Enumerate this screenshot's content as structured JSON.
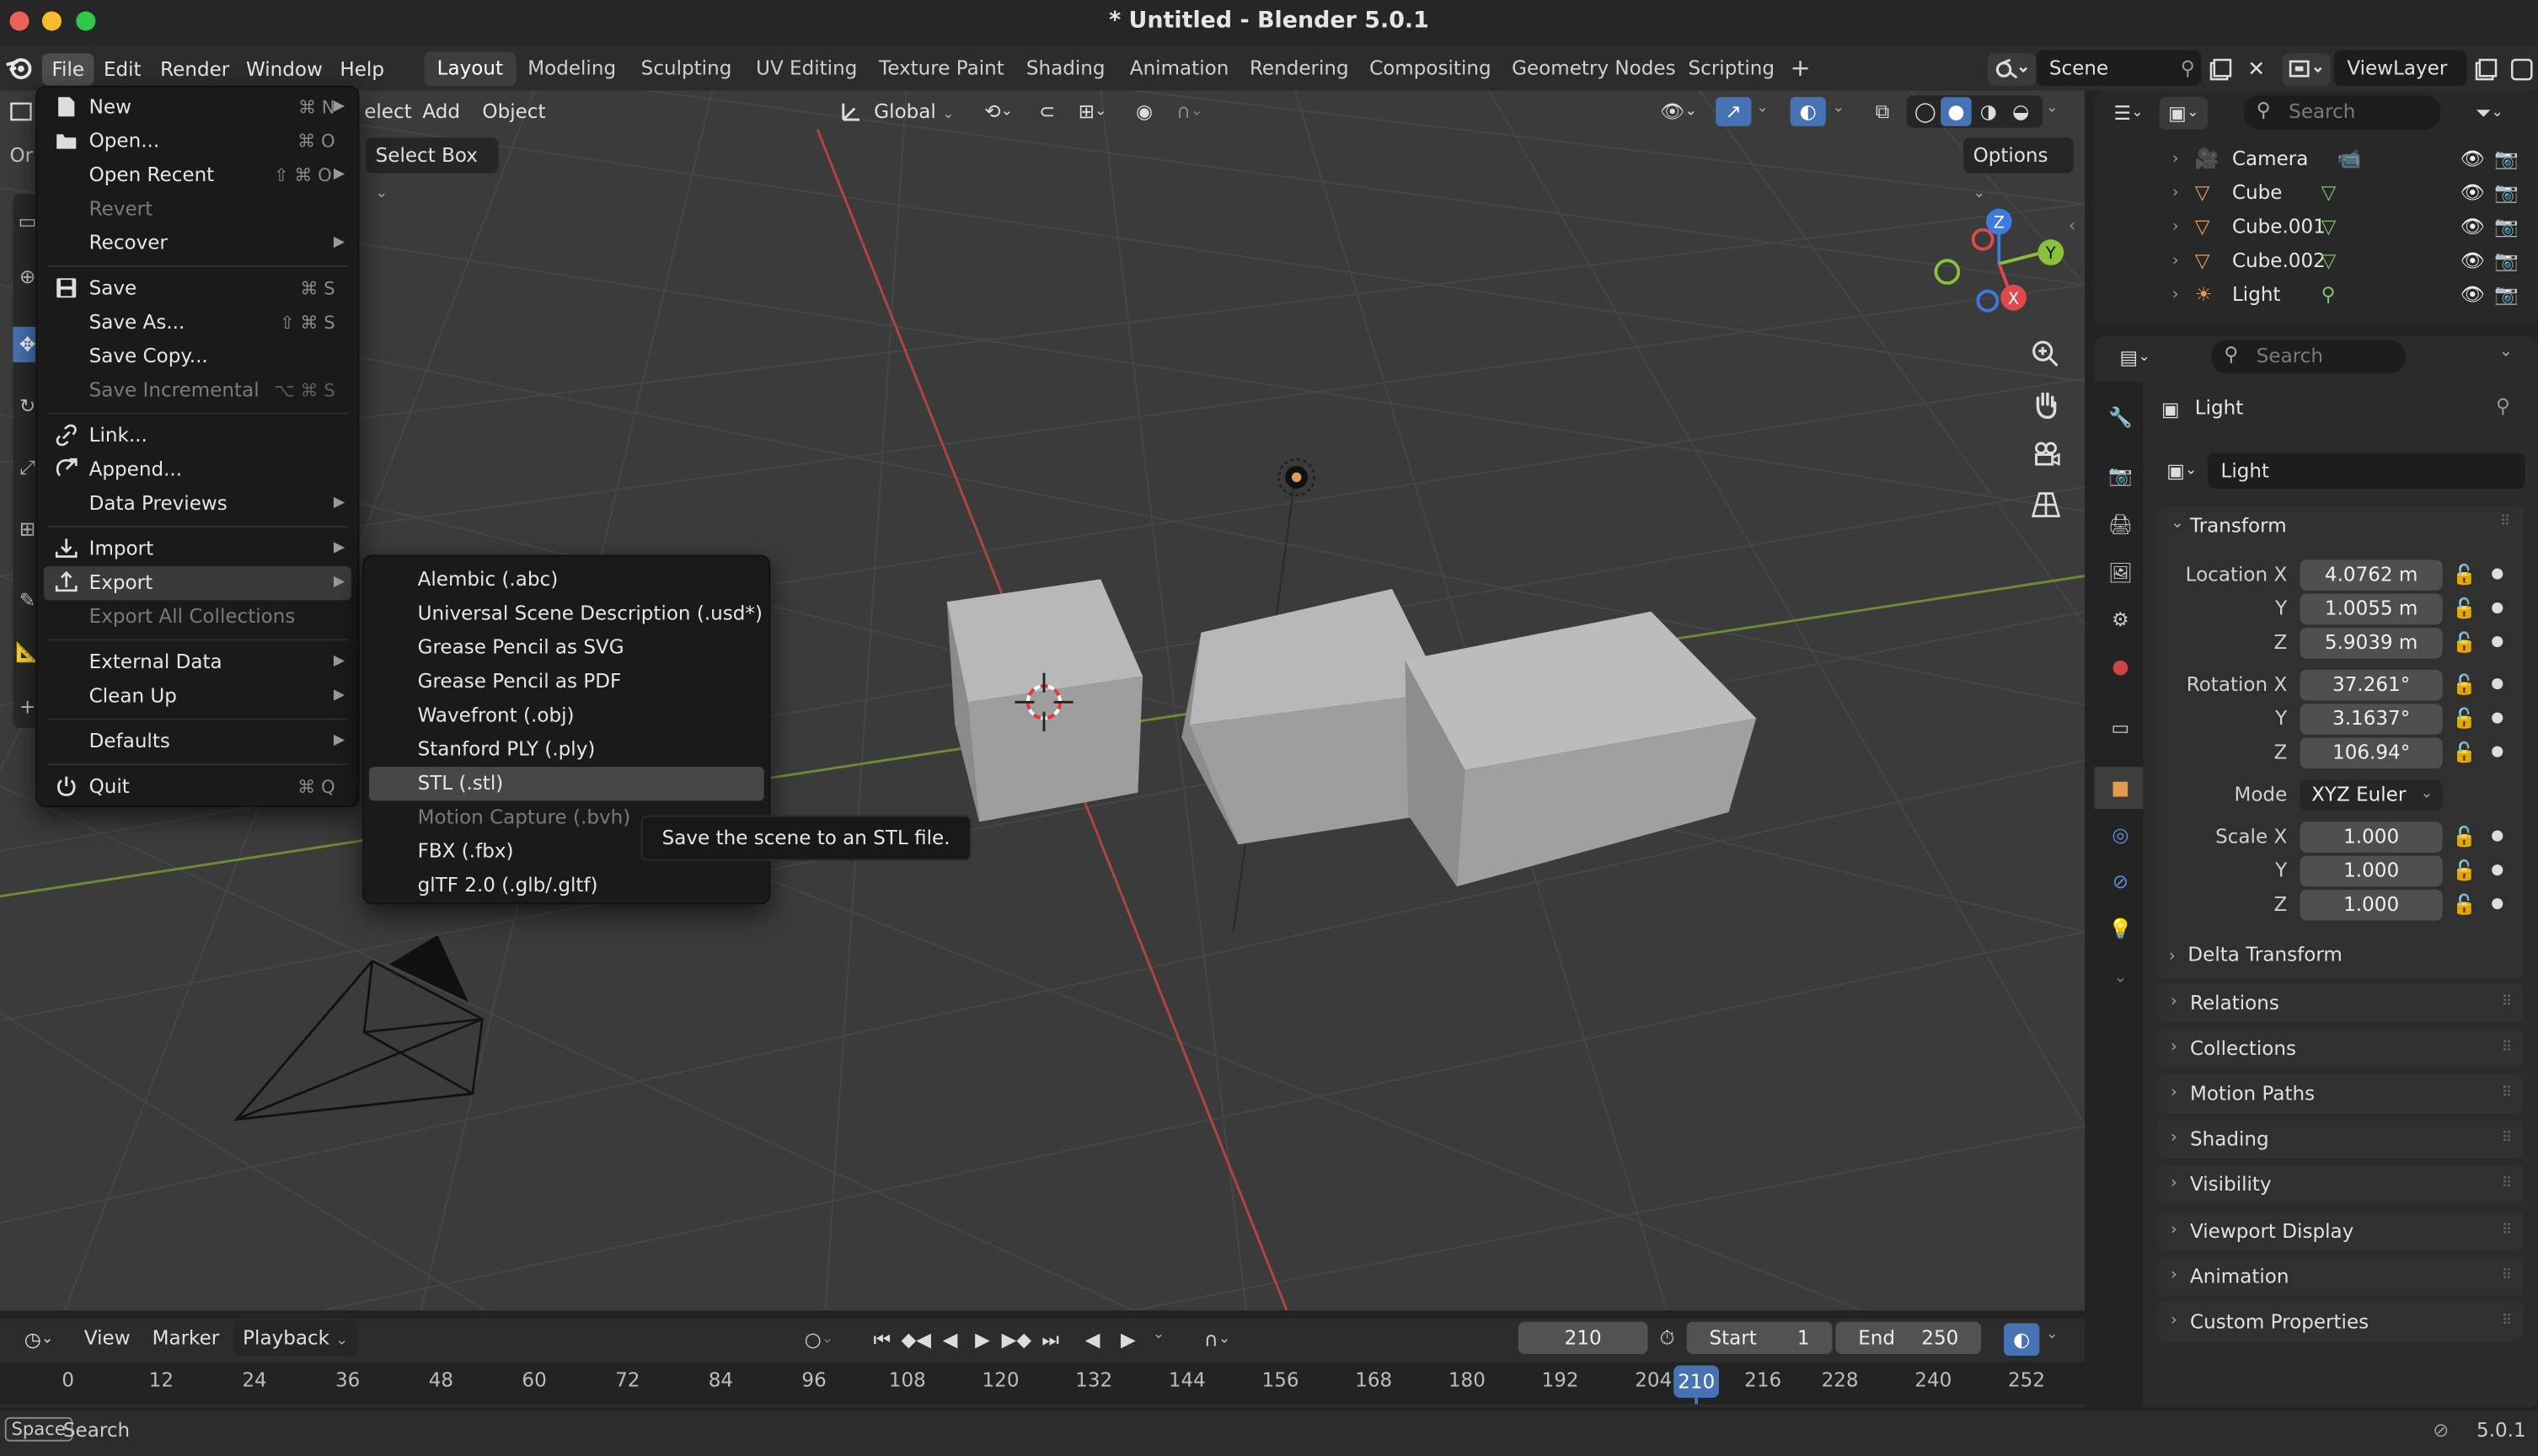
{
  "window": {
    "title": "* Untitled - Blender 5.0.1"
  },
  "menubar": {
    "items": [
      "File",
      "Edit",
      "Render",
      "Window",
      "Help"
    ],
    "workspaces": [
      "Layout",
      "Modeling",
      "Sculpting",
      "UV Editing",
      "Texture Paint",
      "Shading",
      "Animation",
      "Rendering",
      "Compositing",
      "Geometry Nodes",
      "Scripting"
    ],
    "active_workspace": "Layout",
    "add_tab": "+",
    "scene": "Scene",
    "view_layer": "ViewLayer"
  },
  "viewport_header": {
    "select_partial": "elect",
    "add": "Add",
    "object": "Object",
    "transform_orientation": "Global",
    "select_mode": "Select Box",
    "options": "Options",
    "left_partial": "Or"
  },
  "file_menu": {
    "items": [
      {
        "label": "New",
        "shortcut": "⌘ N",
        "submenu": true,
        "icon": "new-file-icon",
        "disabled": false
      },
      {
        "label": "Open...",
        "shortcut": "⌘ O",
        "icon": "folder-icon",
        "disabled": false
      },
      {
        "label": "Open Recent",
        "shortcut": "⇧ ⌘ O",
        "submenu": true,
        "disabled": false
      },
      {
        "label": "Revert",
        "disabled": true
      },
      {
        "label": "Recover",
        "submenu": true,
        "disabled": false
      },
      {
        "label": "Save",
        "shortcut": "⌘ S",
        "icon": "save-icon",
        "disabled": false
      },
      {
        "label": "Save As...",
        "shortcut": "⇧ ⌘ S",
        "disabled": false
      },
      {
        "label": "Save Copy...",
        "disabled": false
      },
      {
        "label": "Save Incremental",
        "shortcut": "⌥ ⌘ S",
        "disabled": true
      },
      {
        "label": "Link...",
        "icon": "link-icon",
        "disabled": false
      },
      {
        "label": "Append...",
        "icon": "append-icon",
        "disabled": false
      },
      {
        "label": "Data Previews",
        "submenu": true,
        "disabled": false
      },
      {
        "label": "Import",
        "submenu": true,
        "icon": "import-icon",
        "disabled": false
      },
      {
        "label": "Export",
        "submenu": true,
        "icon": "export-icon",
        "disabled": false,
        "highlighted": true
      },
      {
        "label": "Export All Collections",
        "disabled": true
      },
      {
        "label": "External Data",
        "submenu": true,
        "disabled": false
      },
      {
        "label": "Clean Up",
        "submenu": true,
        "disabled": false
      },
      {
        "label": "Defaults",
        "submenu": true,
        "disabled": false
      },
      {
        "label": "Quit",
        "shortcut": "⌘ Q",
        "icon": "power-icon",
        "disabled": false
      }
    ]
  },
  "export_menu": {
    "items": [
      {
        "label": "Alembic (.abc)",
        "disabled": false
      },
      {
        "label": "Universal Scene Description (.usd*)",
        "disabled": false
      },
      {
        "label": "Grease Pencil as SVG",
        "disabled": false
      },
      {
        "label": "Grease Pencil as PDF",
        "disabled": false
      },
      {
        "label": "Wavefront (.obj)",
        "disabled": false
      },
      {
        "label": "Stanford PLY (.ply)",
        "disabled": false
      },
      {
        "label": "STL (.stl)",
        "disabled": false,
        "highlighted": true
      },
      {
        "label": "Motion Capture (.bvh)",
        "disabled": true
      },
      {
        "label": "FBX (.fbx)",
        "disabled": false
      },
      {
        "label": "glTF 2.0 (.glb/.gltf)",
        "disabled": false
      }
    ],
    "tooltip": "Save the scene to an STL file."
  },
  "outliner": {
    "search_placeholder": "Search",
    "rows": [
      {
        "name": "Camera",
        "icon": "camera-object-icon",
        "data_icon": "camera-data-icon"
      },
      {
        "name": "Cube",
        "icon": "mesh-object-icon",
        "data_icon": "mesh-data-icon"
      },
      {
        "name": "Cube.001",
        "icon": "mesh-object-icon",
        "data_icon": "mesh-data-icon"
      },
      {
        "name": "Cube.002",
        "icon": "mesh-object-icon",
        "data_icon": "mesh-data-icon"
      },
      {
        "name": "Light",
        "icon": "light-object-icon",
        "data_icon": "light-data-icon"
      }
    ]
  },
  "properties": {
    "search_placeholder": "Search",
    "object_name": "Light",
    "datablock_name": "Light",
    "transform_header": "Transform",
    "location": {
      "label": "Location X",
      "x": "4.0762 m",
      "y": "1.0055 m",
      "z": "5.9039 m"
    },
    "rotation": {
      "label": "Rotation X",
      "x": "37.261°",
      "y": "3.1637°",
      "z": "106.94°"
    },
    "mode": {
      "label": "Mode",
      "value": "XYZ Euler"
    },
    "scale": {
      "label": "Scale X",
      "x": "1.000",
      "y": "1.000",
      "z": "1.000"
    },
    "axis_y": "Y",
    "axis_z": "Z",
    "delta_transform": "Delta Transform",
    "panels": [
      "Relations",
      "Collections",
      "Motion Paths",
      "Shading",
      "Visibility",
      "Viewport Display",
      "Animation",
      "Custom Properties"
    ]
  },
  "timeline": {
    "view": "View",
    "marker": "Marker",
    "playback": "Playback",
    "current_frame": "210",
    "start_label": "Start",
    "start": "1",
    "end_label": "End",
    "end": "250",
    "ruler": [
      "0",
      "12",
      "24",
      "36",
      "48",
      "60",
      "72",
      "84",
      "96",
      "108",
      "120",
      "132",
      "144",
      "156",
      "168",
      "180",
      "192",
      "204",
      "216",
      "228",
      "240",
      "252"
    ],
    "playhead": "210"
  },
  "statusbar": {
    "key": "Space",
    "action": "Search",
    "version": "5.0.1"
  },
  "gizmo": {
    "x": "X",
    "y": "Y",
    "z": "Z"
  },
  "colors": {
    "accent": "#4772b3",
    "axis_x": "#e0484c",
    "axis_y": "#8ac13a",
    "axis_z": "#3d7ae0",
    "object_orange": "#e49a52"
  }
}
